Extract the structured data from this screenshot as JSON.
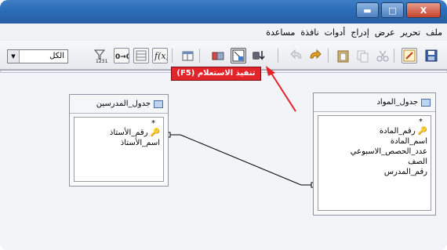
{
  "window": {
    "minimize_glyph": "▬",
    "maximize_glyph": "□",
    "close_glyph": "X"
  },
  "menu": [
    "ملف",
    "تحرير",
    "عرض",
    "إدراج",
    "أدوات",
    "نافذة",
    "مساعدة"
  ],
  "toolbar": {
    "combo_value": "الكل",
    "combo_arrow": "▼",
    "tooltip": "تنفيذ الاستعلام (F5)"
  },
  "tables": {
    "teachers": {
      "title": "جدول_المدرسين",
      "star": "*",
      "fields": [
        "رقم_الأستاذ",
        "اسم_الأستاذ"
      ]
    },
    "subjects": {
      "title": "جدول_المواد",
      "star": "*",
      "fields": [
        "رقم_المادة",
        "اسم_المادة",
        "عدد_الحصص_الاسبوعي",
        "الصف",
        "رقم_المدرس"
      ]
    }
  },
  "colors": {
    "titlebar": "#2d6eb9",
    "tooltip_bg": "#e3242b",
    "arrow": "#e3242b",
    "key": "#d4a010"
  }
}
